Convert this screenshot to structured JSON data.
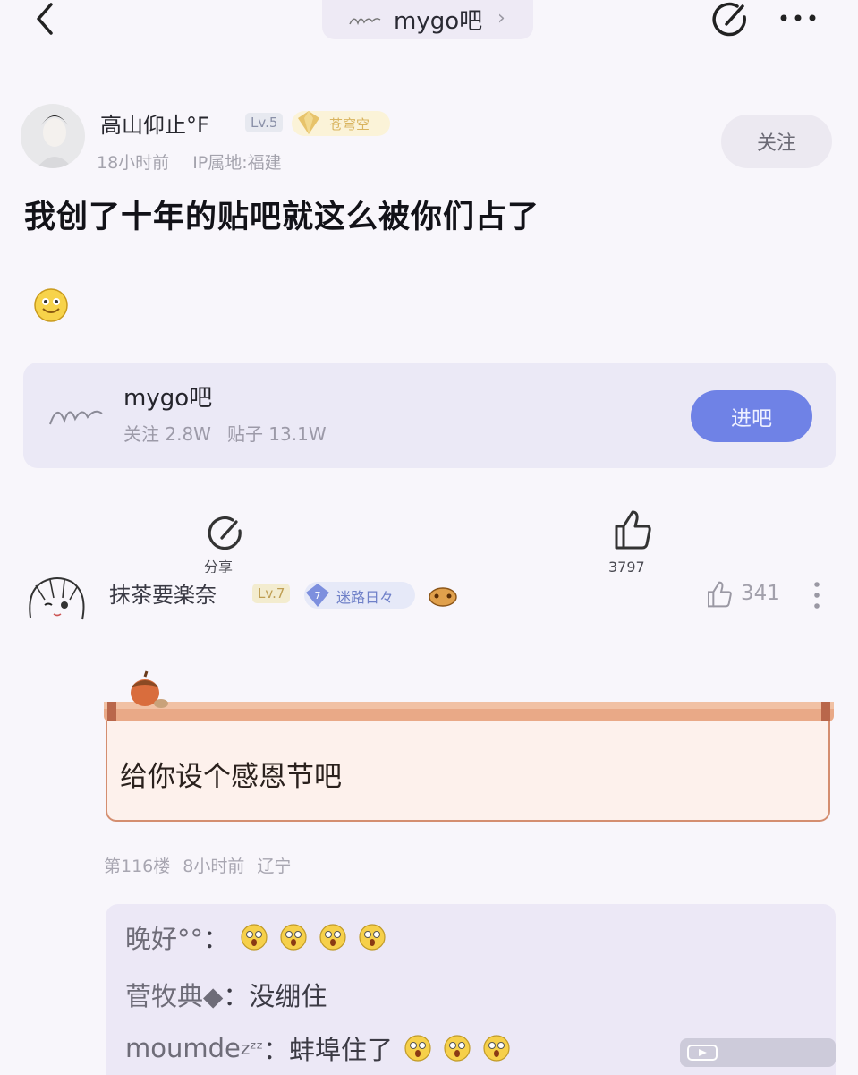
{
  "topbar": {
    "forum_title": "mygo吧",
    "chevron": "›",
    "icons": [
      "back-icon",
      "mygo-logo",
      "edit-icon",
      "more-icon"
    ]
  },
  "post": {
    "author": {
      "name": "高山仰止°F",
      "level": "Lv.5",
      "badge": "苍穹空",
      "time": "18小时前",
      "ip": "IP属地:福建"
    },
    "follow_label": "关注",
    "title": "我创了十年的贴吧就这么被你们占了",
    "emoji": "smile-emoji"
  },
  "forum_card": {
    "name": "mygo吧",
    "followers": "关注 2.8W",
    "posts": "贴子 13.1W",
    "enter_label": "进吧"
  },
  "actions": {
    "share_label": "分享",
    "like_count": "3797"
  },
  "comment": {
    "user": "抹茶要楽奈",
    "level": "Lv.7",
    "badge_num": "7",
    "badge": "迷路日々",
    "likes": "341",
    "text": "给你设个感恩节吧",
    "floor": "第116楼",
    "time": "8小时前",
    "location": "辽宁"
  },
  "replies": [
    {
      "name": "晚好°°",
      "sep": "：",
      "text": "",
      "emoji_count": 4
    },
    {
      "name": "菅牧典◆",
      "sep": "：",
      "text": "没绷住",
      "emoji_count": 0
    },
    {
      "name": "moumde",
      "zzz": "zᶻᶻ",
      "sep": "：",
      "text": "蚌埠住了",
      "emoji_count": 3
    }
  ],
  "colors": {
    "accent": "#6f82e6",
    "bubble_border": "#d48e70",
    "badge_gold": "#d9b45f"
  }
}
